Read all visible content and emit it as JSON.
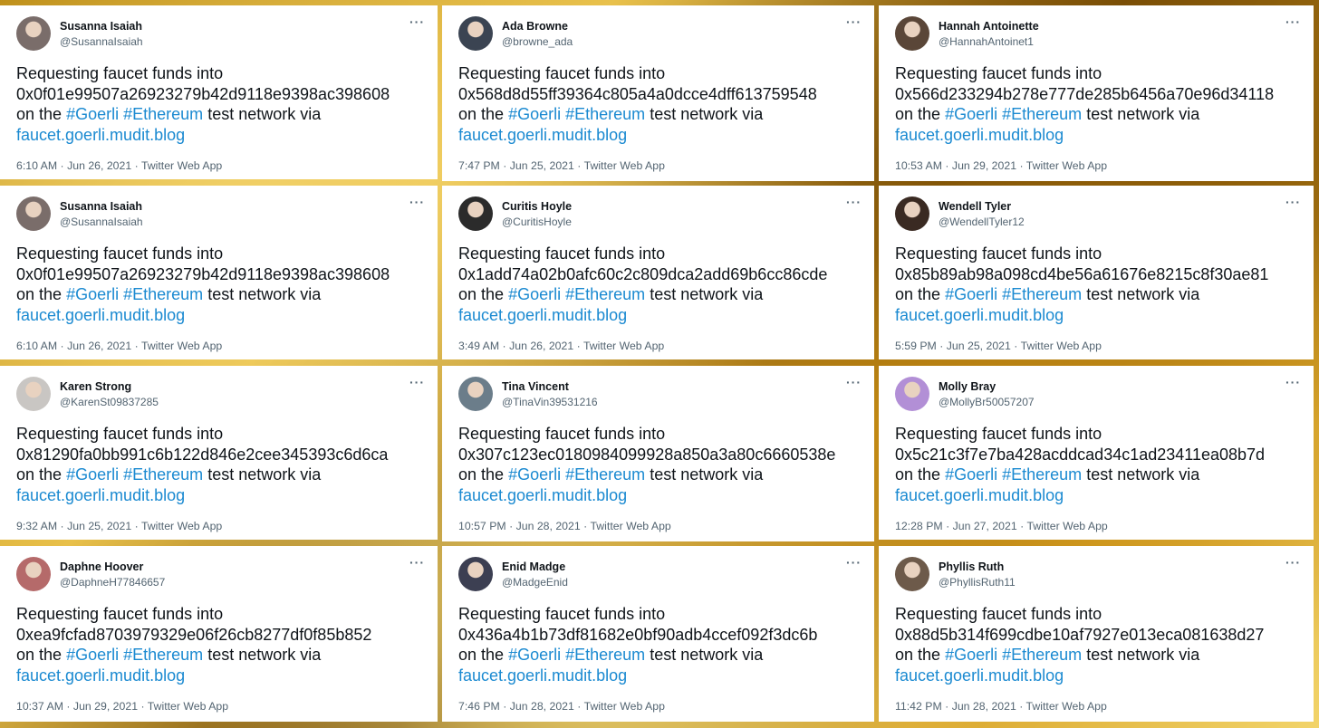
{
  "common": {
    "line1": "Requesting faucet funds into",
    "on_the": "on the",
    "tag1": "#Goerli",
    "tag2": "#Ethereum",
    "tail": "test network via",
    "url": "faucet.goerli.mudit.blog",
    "sep": "·",
    "app": "Twitter Web App",
    "more": "···"
  },
  "tweets": [
    {
      "name": "Susanna Isaiah",
      "handle": "@SusannaIsaiah",
      "address": "0x0f01e99507a26923279b42d9118e9398ac398608",
      "time": "6:10 AM",
      "date": "Jun 26, 2021",
      "avatar_color": "#7a6d6a"
    },
    {
      "name": "Ada Browne",
      "handle": "@browne_ada",
      "address": "0x568d8d55ff39364c805a4a0dcce4dff613759548",
      "time": "7:47 PM",
      "date": "Jun 25, 2021",
      "avatar_color": "#3b4452"
    },
    {
      "name": "Hannah Antoinette",
      "handle": "@HannahAntoinet1",
      "address": "0x566d233294b278e777de285b6456a70e96d34118",
      "time": "10:53 AM",
      "date": "Jun 29, 2021",
      "avatar_color": "#5a4638"
    },
    {
      "name": "Susanna Isaiah",
      "handle": "@SusannaIsaiah",
      "address": "0x0f01e99507a26923279b42d9118e9398ac398608",
      "time": "6:10 AM",
      "date": "Jun 26, 2021",
      "avatar_color": "#7a6d6a"
    },
    {
      "name": "Curitis Hoyle",
      "handle": "@CuritisHoyle",
      "address": "0x1add74a02b0afc60c2c809dca2add69b6cc86cde",
      "time": "3:49 AM",
      "date": "Jun 26, 2021",
      "avatar_color": "#2b2b2b"
    },
    {
      "name": "Wendell Tyler",
      "handle": "@WendellTyler12",
      "address": "0x85b89ab98a098cd4be56a61676e8215c8f30ae81",
      "time": "5:59 PM",
      "date": "Jun 25, 2021",
      "avatar_color": "#3a2a22"
    },
    {
      "name": "Karen Strong",
      "handle": "@KarenSt09837285",
      "address": "0x81290fa0bb991c6b122d846e2cee345393c6d6ca",
      "time": "9:32 AM",
      "date": "Jun 25, 2021",
      "avatar_color": "#c9c6c3"
    },
    {
      "name": "Tina Vincent",
      "handle": "@TinaVin39531216",
      "address": "0x307c123ec0180984099928a850a3a80c6660538e",
      "time": "10:57 PM",
      "date": "Jun 28, 2021",
      "avatar_color": "#6b7d8a"
    },
    {
      "name": "Molly Bray",
      "handle": "@MollyBr50057207",
      "address": "0x5c21c3f7e7ba428acddcad34c1ad23411ea08b7d",
      "time": "12:28 PM",
      "date": "Jun 27, 2021",
      "avatar_color": "#b28fd6"
    },
    {
      "name": "Daphne Hoover",
      "handle": "@DaphneH77846657",
      "address": "0xea9fcfad8703979329e06f26cb8277df0f85b852",
      "time": "10:37 AM",
      "date": "Jun 29, 2021",
      "avatar_color": "#b56a6a"
    },
    {
      "name": "Enid Madge",
      "handle": "@MadgeEnid",
      "address": "0x436a4b1b73df81682e0bf90adb4ccef092f3dc6b",
      "time": "7:46 PM",
      "date": "Jun 28, 2021",
      "avatar_color": "#3c3f52"
    },
    {
      "name": "Phyllis Ruth",
      "handle": "@PhyllisRuth11",
      "address": "0x88d5b314f699cdbe10af7927e013eca081638d27",
      "time": "11:42 PM",
      "date": "Jun 28, 2021",
      "avatar_color": "#6d5a4a"
    }
  ]
}
